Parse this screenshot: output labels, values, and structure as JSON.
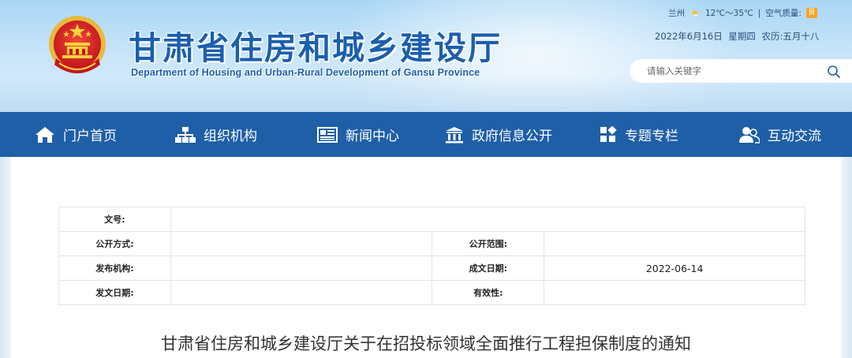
{
  "header": {
    "title_cn": "甘肃省住房和城乡建设厅",
    "title_en": "Department of Housing and Urban-Rural Development of Gansu Province"
  },
  "weather": {
    "city": "兰州",
    "temperature": "12℃～35℃",
    "separator": "|",
    "air_quality_label": "空气质量:",
    "air_quality_value": "良",
    "icon": "sun-cloud-icon"
  },
  "date": {
    "text": "2022年6月16日   星期四   农历:五月十八"
  },
  "search": {
    "placeholder": "请输入关键字"
  },
  "nav": {
    "items": [
      {
        "label": "门户首页",
        "icon": "home-icon"
      },
      {
        "label": "组织机构",
        "icon": "org-chart-icon"
      },
      {
        "label": "新闻中心",
        "icon": "news-icon"
      },
      {
        "label": "政府信息公开",
        "icon": "government-building-icon"
      },
      {
        "label": "专题专栏",
        "icon": "grid-icon"
      },
      {
        "label": "互动交流",
        "icon": "users-icon"
      }
    ]
  },
  "info_table": {
    "doc_number_label": "文号:",
    "doc_number_value": "",
    "disclosure_method_label": "公开方式:",
    "disclosure_method_value": "",
    "disclosure_scope_label": "公开范围:",
    "disclosure_scope_value": "",
    "issuing_org_label": "发布机构:",
    "issuing_org_value": "",
    "created_date_label": "成文日期:",
    "created_date_value": "2022-06-14",
    "issue_date_label": "发文日期:",
    "issue_date_value": "",
    "validity_label": "有效性:",
    "validity_value": ""
  },
  "document": {
    "title": "甘肃省住房和城乡建设厅关于在招投标领域全面推行工程担保制度的通知"
  },
  "colors": {
    "nav_bg": "#1f5fa8",
    "title_blue": "#1b5fae",
    "header_sky": "#a9d6f5"
  }
}
